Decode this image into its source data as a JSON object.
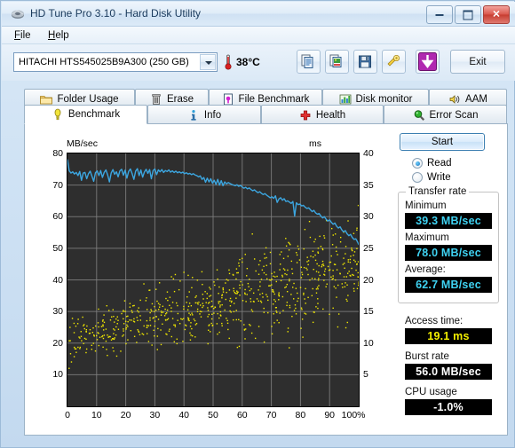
{
  "window": {
    "title": "HD Tune Pro 3.10 - Hard Disk Utility",
    "minimize_label": "Minimize",
    "maximize_label": "Maximize",
    "close_label": "✕"
  },
  "menu": {
    "items": [
      "File",
      "Help"
    ]
  },
  "drive": {
    "selected": "HITACHI HTS545025B9A300 (250 GB)",
    "temperature": "38°C"
  },
  "toolbar": {
    "buttons": [
      {
        "name": "copy-text-button",
        "tip": "Copy text"
      },
      {
        "name": "copy-image-button",
        "tip": "Copy image"
      },
      {
        "name": "save-button",
        "tip": "Save"
      },
      {
        "name": "settings-button",
        "tip": "Options"
      },
      {
        "name": "download-button",
        "tip": "Download"
      }
    ],
    "exit_label": "Exit"
  },
  "tabs": {
    "top_row": [
      {
        "label": "Folder Usage",
        "icon": "folder-icon",
        "active": false
      },
      {
        "label": "Erase",
        "icon": "trash-icon",
        "active": false
      },
      {
        "label": "File Benchmark",
        "icon": "file-benchmark-icon",
        "active": false
      },
      {
        "label": "Disk monitor",
        "icon": "bar-chart-icon",
        "active": false
      },
      {
        "label": "AAM",
        "icon": "speaker-icon",
        "active": false
      }
    ],
    "bottom_row": [
      {
        "label": "Benchmark",
        "icon": "benchmark-icon",
        "active": true
      },
      {
        "label": "Info",
        "icon": "info-icon",
        "active": false
      },
      {
        "label": "Health",
        "icon": "health-cross-icon",
        "active": false
      },
      {
        "label": "Error Scan",
        "icon": "magnifier-icon",
        "active": false
      }
    ]
  },
  "controls": {
    "start_label": "Start",
    "read_label": "Read",
    "write_label": "Write",
    "mode_selected": "Read"
  },
  "transfer_rate": {
    "group_label": "Transfer rate",
    "minimum_label": "Minimum",
    "minimum_value": "39.3 MB/sec",
    "maximum_label": "Maximum",
    "maximum_value": "78.0 MB/sec",
    "average_label": "Average:",
    "average_value": "62.7 MB/sec"
  },
  "metrics": {
    "access_time_label": "Access time:",
    "access_time_value": "19.1 ms",
    "burst_rate_label": "Burst rate",
    "burst_rate_value": "56.0 MB/sec",
    "cpu_usage_label": "CPU usage",
    "cpu_usage_value": "-1.0%"
  },
  "colors": {
    "transfer_line": "#3ca6e0",
    "access_dots": "#f2e900",
    "lcd_cyan": "#3fd2f2",
    "lcd_yellow": "#f4f000",
    "plot_background": "#2e2e2e",
    "grid": "#808080"
  },
  "chart_data": {
    "type": "line",
    "title": "",
    "xlabel": "100%",
    "ylabel": "MB/sec",
    "y2label": "ms",
    "xlim": [
      0,
      100
    ],
    "ylim": [
      0,
      80
    ],
    "y2lim": [
      0,
      40
    ],
    "grid": true,
    "legend": "none",
    "xticks": [
      0,
      10,
      20,
      30,
      40,
      50,
      60,
      70,
      80,
      90,
      100
    ],
    "xticklabels": [
      "0",
      "10",
      "20",
      "30",
      "40",
      "50",
      "60",
      "70",
      "80",
      "90",
      "100%"
    ],
    "yticks": [
      10,
      20,
      30,
      40,
      50,
      60,
      70,
      80
    ],
    "y2ticks": [
      5,
      10,
      15,
      20,
      25,
      30,
      35,
      40
    ],
    "series": [
      {
        "name": "Transfer rate",
        "type": "line",
        "axis": "left",
        "color": "#3ca6e0",
        "unit": "MB/sec",
        "x": [
          0,
          0.6,
          1.2,
          1.8,
          2.4,
          3,
          3.6,
          4.2,
          4.8,
          5.4,
          6,
          6.6,
          7.2,
          7.8,
          8.4,
          9,
          9.6,
          10.2,
          10.8,
          11.4,
          12,
          12.6,
          13.2,
          13.8,
          14.4,
          15,
          15.6,
          16.2,
          16.8,
          17.4,
          18,
          18.6,
          19.2,
          19.8,
          20.4,
          21,
          21.6,
          22.2,
          22.8,
          23.4,
          24,
          24.6,
          25.2,
          25.8,
          26.4,
          27,
          27.6,
          28.2,
          28.8,
          29.4,
          30,
          30.6,
          31.2,
          31.8,
          32.4,
          33,
          33.6,
          34.2,
          34.8,
          35.4,
          36,
          36.6,
          37.2,
          37.8,
          38.4,
          39,
          39.6,
          40.2,
          40.8,
          41.4,
          42,
          42.6,
          43.2,
          43.8,
          44.4,
          45,
          45.6,
          46.2,
          46.8,
          47.4,
          48,
          48.6,
          49.2,
          49.8,
          50.4,
          51,
          51.6,
          52.2,
          52.8,
          53.4,
          54,
          54.6,
          55.2,
          55.8,
          56.4,
          57,
          57.6,
          58.2,
          58.8,
          59.4,
          60,
          60.6,
          61.2,
          61.8,
          62.4,
          63,
          63.6,
          64.2,
          64.8,
          65.4,
          66,
          66.6,
          67.2,
          67.8,
          68.4,
          69,
          69.6,
          70.2,
          70.8,
          71.4,
          72,
          72.6,
          73.2,
          73.8,
          74.4,
          75,
          75.6,
          76.2,
          76.8,
          77.4,
          78,
          78.6,
          79.2,
          79.8,
          80.4,
          81,
          81.6,
          82.2,
          82.8,
          83.4,
          84,
          84.6,
          85.2,
          85.8,
          86.4,
          87,
          87.6,
          88.2,
          88.8,
          89.4,
          90,
          90.6,
          91.2,
          91.8,
          92.4,
          93,
          93.6,
          94.2,
          94.8,
          95.4,
          96,
          96.6,
          97.2,
          97.8,
          98.4,
          99,
          99.6,
          100
        ],
        "y": [
          78.0,
          74.5,
          73.8,
          74.2,
          73.5,
          74.0,
          73.0,
          74.3,
          71.5,
          73.8,
          74.0,
          72.0,
          73.6,
          74.4,
          72.8,
          71.2,
          73.9,
          74.5,
          73.0,
          74.6,
          72.4,
          74.0,
          74.8,
          73.2,
          71.0,
          73.8,
          74.9,
          73.4,
          74.2,
          72.6,
          74.5,
          75.0,
          73.1,
          74.7,
          72.2,
          74.3,
          75.1,
          73.6,
          71.8,
          74.4,
          75.2,
          73.0,
          74.8,
          72.5,
          74.1,
          75.0,
          73.7,
          74.9,
          72.0,
          74.6,
          75.1,
          73.3,
          74.8,
          74.2,
          74.9,
          74.0,
          74.6,
          74.3,
          74.8,
          74.1,
          74.5,
          74.0,
          74.4,
          73.9,
          74.2,
          73.8,
          74.1,
          73.6,
          73.9,
          73.5,
          73.7,
          73.3,
          73.6,
          73.2,
          73.0,
          72.6,
          72.9,
          71.8,
          72.4,
          70.9,
          72.2,
          71.0,
          72.0,
          70.6,
          71.5,
          70.2,
          71.8,
          70.0,
          71.4,
          69.8,
          71.0,
          70.4,
          70.8,
          70.5,
          70.2,
          70.0,
          69.8,
          70.1,
          69.6,
          69.9,
          69.4,
          69.0,
          69.3,
          68.8,
          69.1,
          68.6,
          68.2,
          68.5,
          68.0,
          67.6,
          67.9,
          67.4,
          67.0,
          67.3,
          66.8,
          66.4,
          66.0,
          66.3,
          65.8,
          66.6,
          64.5,
          65.6,
          66.0,
          65.2,
          65.7,
          64.8,
          65.0,
          64.6,
          64.2,
          64.8,
          60.2,
          64.4,
          63.8,
          64.0,
          63.4,
          63.6,
          63.0,
          62.6,
          62.8,
          62.2,
          61.6,
          62.0,
          61.2,
          60.8,
          61.0,
          60.2,
          59.6,
          60.0,
          59.2,
          58.6,
          59.0,
          58.2,
          57.6,
          58.0,
          57.0,
          56.4,
          56.8,
          55.8,
          55.2,
          55.6,
          54.6,
          54.0,
          54.4,
          53.4,
          52.8,
          53.0,
          52.0,
          51.2,
          50.4,
          49.6,
          48.8,
          47.8,
          46.6,
          45.2,
          43.6,
          42.0,
          40.6,
          39.8,
          39.3
        ]
      },
      {
        "name": "Access time",
        "type": "scatter",
        "axis": "right",
        "color": "#f2e900",
        "unit": "ms",
        "description": "Random access-time samples, rising from ~10 ms near the start of the disk to ~25-30 ms at the end; average 19.1 ms",
        "average": 19.1
      }
    ]
  }
}
